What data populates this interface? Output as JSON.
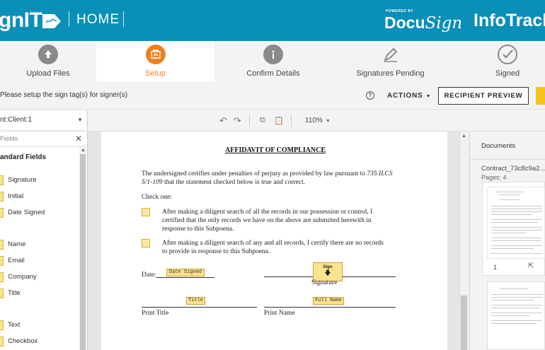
{
  "header": {
    "brand": "gnIT",
    "section": "HOME",
    "powered_by": "POWERED BY",
    "docusign_docu": "Docu",
    "docusign_sign": "Sign",
    "infotrack": "InfoTrack"
  },
  "steps": [
    {
      "label": "Upload Files",
      "icon": "upload-icon"
    },
    {
      "label": "Setup",
      "icon": "setup-icon"
    },
    {
      "label": "Confirm Details",
      "icon": "info-icon"
    },
    {
      "label": "Signatures Pending",
      "icon": "pen-icon"
    },
    {
      "label": "Signed",
      "icon": "check-icon"
    }
  ],
  "instruction_bar": {
    "message": "Please setup the sign tag(s) for signer(s)",
    "help_symbol": "?",
    "actions_label": "ACTIONS",
    "recipient_preview_label": "RECIPIENT PREVIEW"
  },
  "toolbar": {
    "recipient_value": "nt:Client:1",
    "zoom_value": "110%"
  },
  "left_panel": {
    "search_placeholder": "Fields",
    "group_title": "andard Fields",
    "items": [
      "Signature",
      "Initial",
      "Date Signed",
      "Name",
      "Email",
      "Company",
      "Title",
      "Text",
      "Checkbox"
    ]
  },
  "document": {
    "title": "AFFIDAVIT OF COMPLIANCE",
    "intro_line1_a": "The undersigned certifies under penalties of perjury as provided by law pursuant to ",
    "intro_line1_b": "735 ILCS",
    "intro_line2_a": "5/1-109",
    "intro_line2_b": " that the statement checked below is true and correct.",
    "check_one": "Check one:",
    "option1": [
      "After making a diligent search of all the records in our possession or control, I",
      "certified that the only records we have on the above are submitted herewith in",
      "response to this Subpoena."
    ],
    "option2": [
      "After making a diligent search of any and all records, I certify there are no records",
      "to provide in response to this Subpoena."
    ],
    "date_label": "Date:",
    "date_tag": "Date Signed",
    "sign_tag": "Sign",
    "signature_label": "Signature",
    "title_tag": "Title",
    "fullname_tag": "Full Name",
    "print_title": "Print Title",
    "print_name": "Print Name"
  },
  "right_panel": {
    "title": "Documents",
    "doc_name": "Contract_73c8c9a2...",
    "pages": "Pages: 4",
    "page_num": "1"
  },
  "colors": {
    "header": "#0a8fb8",
    "active_step": "#f07f1d",
    "tag_fill": "#fbe38e",
    "primary_button": "#f6c41a"
  }
}
